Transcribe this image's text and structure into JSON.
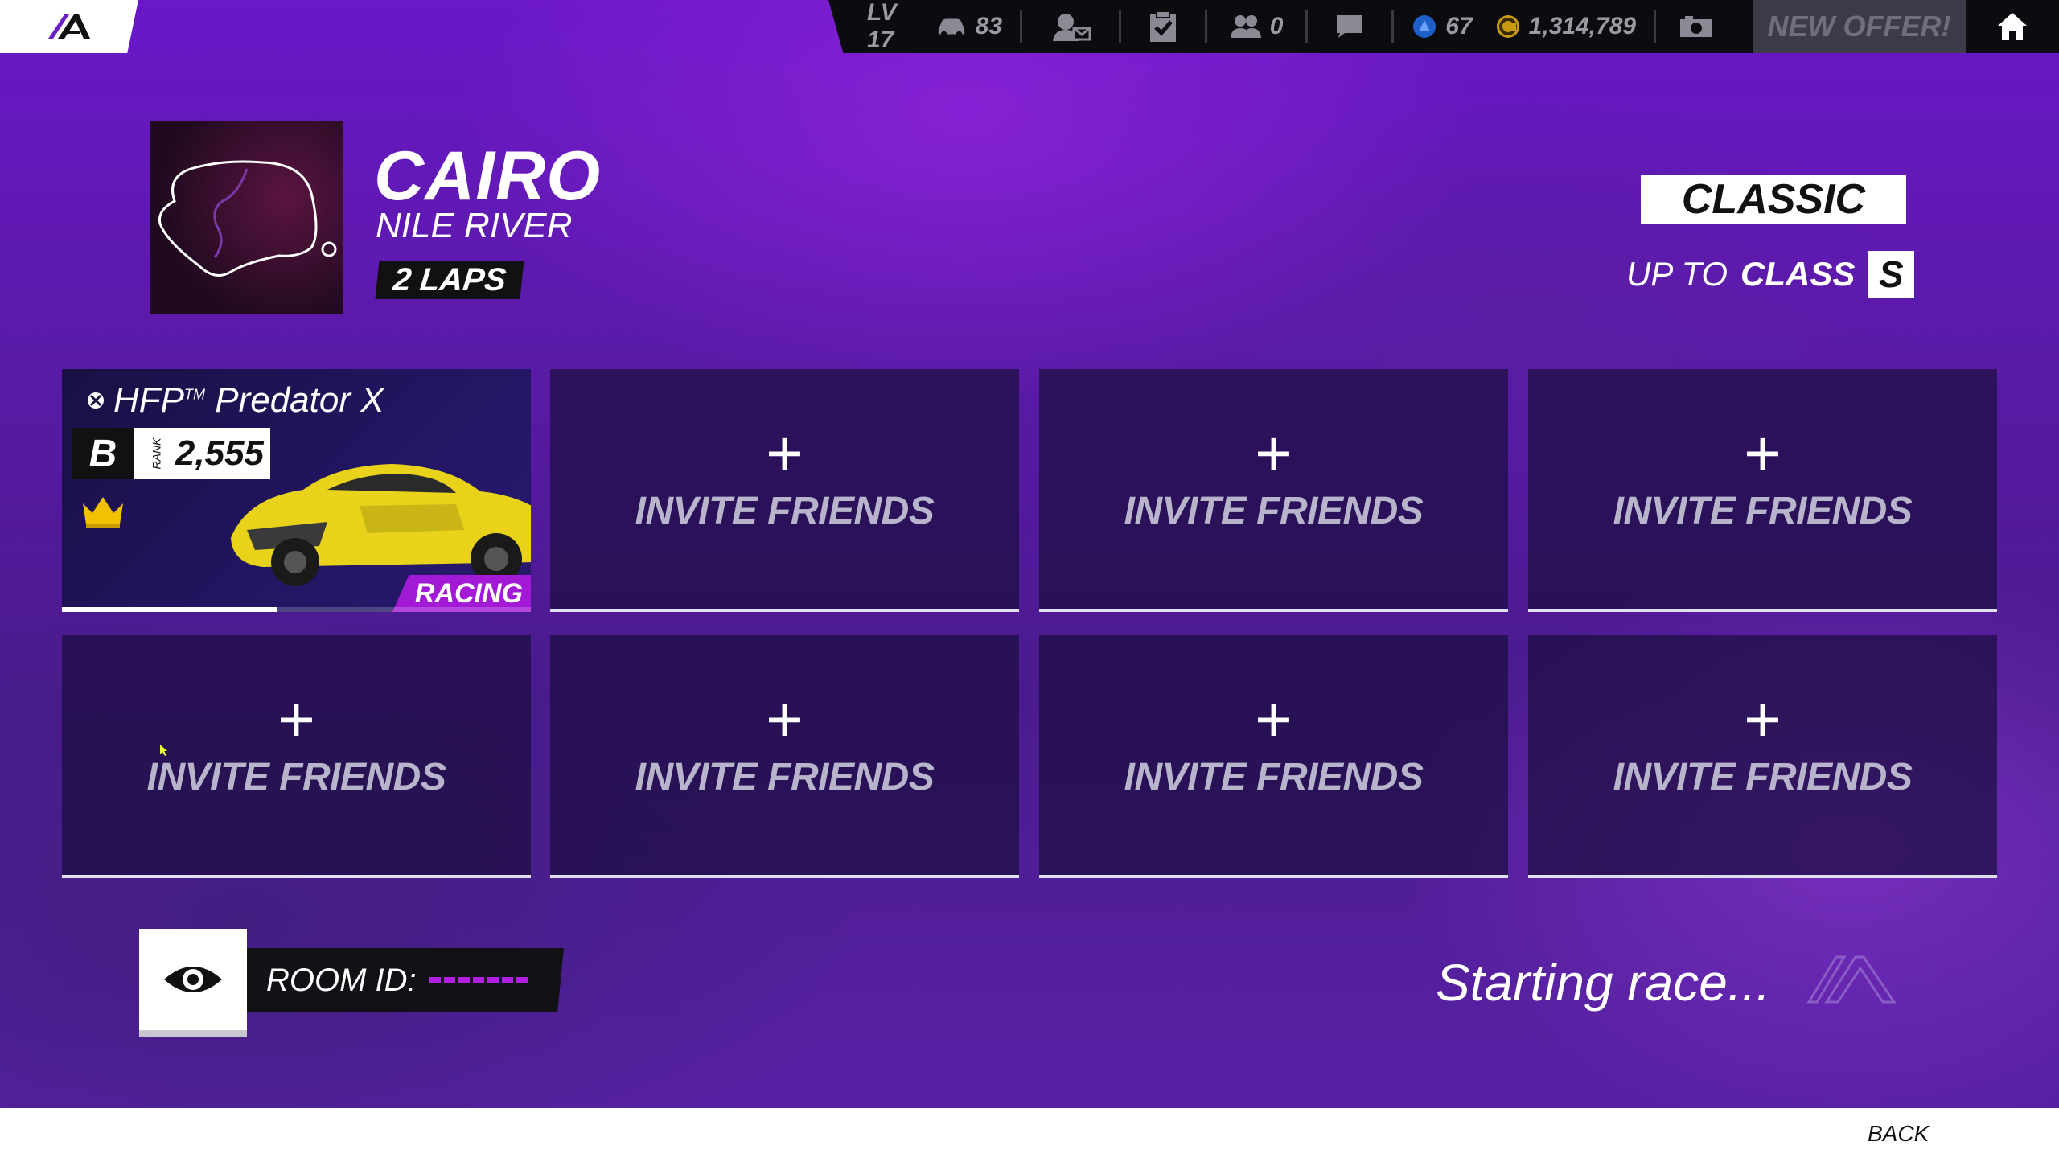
{
  "top_bar": {
    "level": "LV 17",
    "cars_count": "83",
    "friends_count": "0",
    "tokens": "67",
    "credits": "1,314,789",
    "offer_label": "NEW OFFER!"
  },
  "track": {
    "name": "CAIRO",
    "subtitle": "NILE RIVER",
    "laps": "2 LAPS"
  },
  "mode": {
    "label": "CLASSIC",
    "class_prefix": "UP TO",
    "class_word": "CLASS",
    "class_letter": "S"
  },
  "player": {
    "car_name": "HFP",
    "car_tm": "TM",
    "car_model": "Predator X",
    "rank_letter": "B",
    "rank_label": "RANK",
    "rank_value": "2,555",
    "tag": "RACING",
    "progress": 0.46
  },
  "slots": {
    "plus": "+",
    "invite_label": "INVITE FRIENDS"
  },
  "room": {
    "label": "ROOM ID:"
  },
  "status": {
    "starting": "Starting race..."
  },
  "footer": {
    "back_label": "BACK"
  },
  "colors": {
    "accent_purple": "#a21ad6",
    "crown_gold": "#f2c200",
    "car_yellow": "#e8d21a"
  }
}
